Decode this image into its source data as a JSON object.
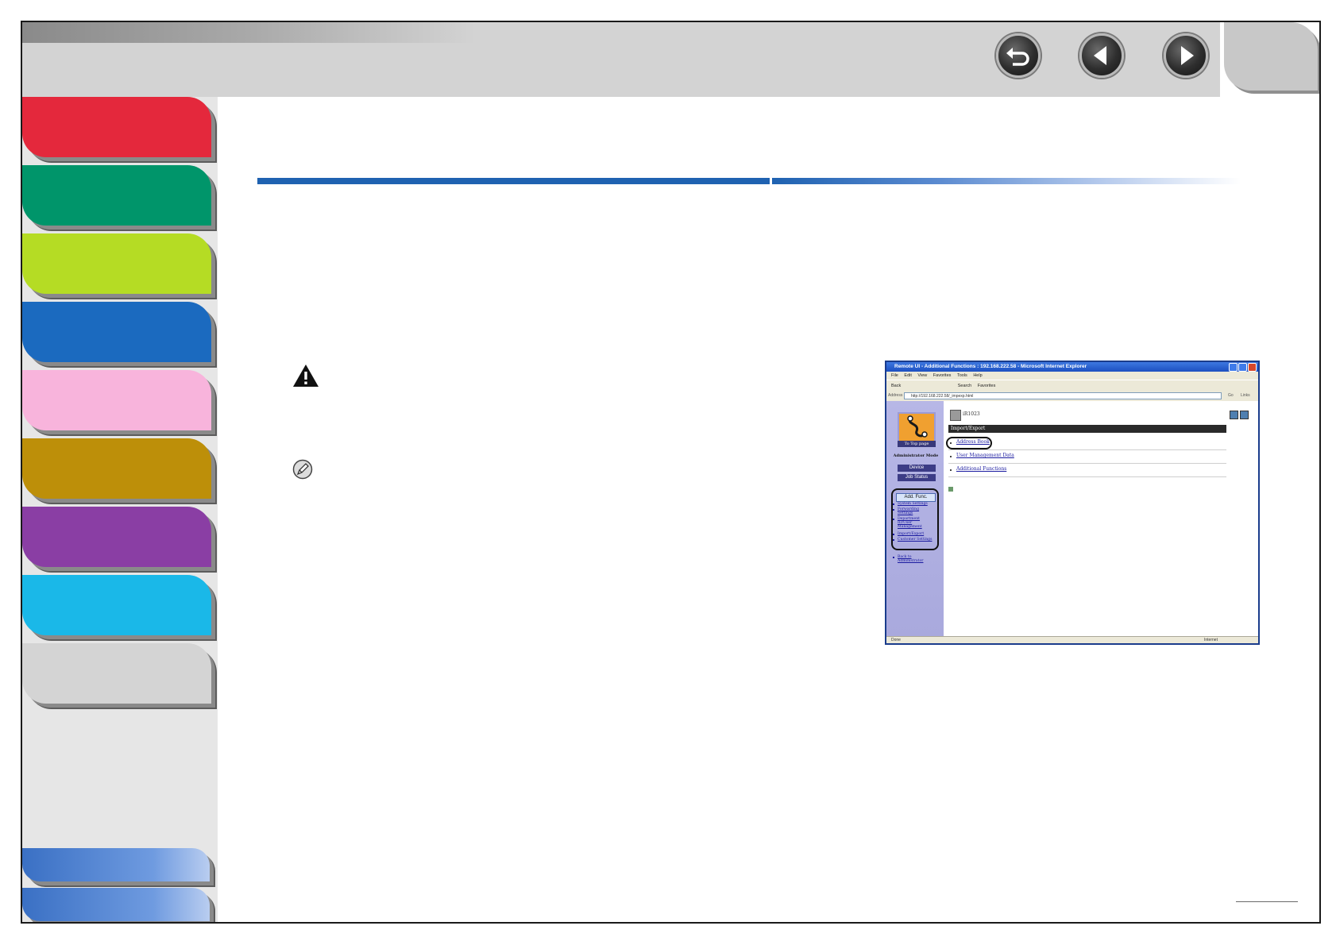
{
  "header": {
    "nav_buttons": [
      {
        "name": "back",
        "icon": "return-arrow-icon"
      },
      {
        "name": "previous",
        "icon": "triangle-left-icon"
      },
      {
        "name": "next",
        "icon": "triangle-right-icon"
      }
    ]
  },
  "sidebar": {
    "chapter_tabs": [
      {
        "color": "#e4283c"
      },
      {
        "color": "#00956a"
      },
      {
        "color": "#b5dc24"
      },
      {
        "color": "#1b6abf"
      },
      {
        "color": "#f8b4dc"
      },
      {
        "color": "#bd8f09"
      },
      {
        "color": "#8a3ea4"
      },
      {
        "color": "#1ab8e8"
      },
      {
        "color": "#d4d4d4"
      }
    ],
    "link_tabs": [
      {
        "color": "#4a82d4"
      },
      {
        "color": "#4a82d4"
      }
    ]
  },
  "colors": {
    "title_rule": "#1f62b1"
  },
  "screenshot": {
    "window_title": "Remote UI - Additional Functions : 192.168.222.58 - Microsoft Internet Explorer",
    "menu": [
      "File",
      "Edit",
      "View",
      "Favorites",
      "Tools",
      "Help"
    ],
    "toolbar": [
      "Back",
      "Search",
      "Favorites"
    ],
    "address_label": "Address",
    "address_value": "http://192.168.222.58/_impexp.html",
    "go_label": "Go",
    "links_label": "Links",
    "status_left": "Done",
    "status_right": "Internet",
    "sidebar": {
      "top_page": "To Top page",
      "admin_mode": "Administrator Mode",
      "buttons": [
        "Device",
        "Job Status"
      ],
      "add_func": "Add. Func.",
      "links": [
        "System Settings",
        "Forwarding Settings",
        "Department ID/User Management",
        "Import/Export",
        "Customer Settings"
      ],
      "manual_link": "Back to Administrator"
    },
    "main": {
      "device_name": "iR1023",
      "section_title": "Import/Export",
      "links": [
        "Address Book",
        "User Management Data",
        "Additional Functions"
      ]
    }
  }
}
